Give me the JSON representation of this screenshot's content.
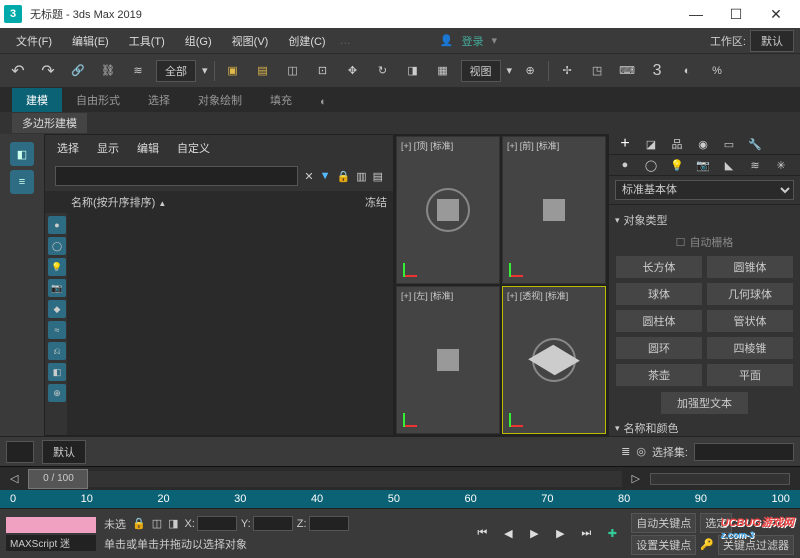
{
  "title": "无标题 - 3ds Max 2019",
  "menus": {
    "file": "文件(F)",
    "edit": "编辑(E)",
    "tools": "工具(T)",
    "group": "组(G)",
    "views": "视图(V)",
    "create": "创建(C)",
    "login": "登录",
    "workspace_label": "工作区:",
    "workspace_value": "默认"
  },
  "toolbar": {
    "all": "全部",
    "view": "视图"
  },
  "tabs": {
    "modeling": "建模",
    "freeform": "自由形式",
    "selection": "选择",
    "object_paint": "对象绘制",
    "fill": "填充"
  },
  "subtab": "多边形建模",
  "scene_explorer": {
    "menu": {
      "select": "选择",
      "display": "显示",
      "edit": "编辑",
      "custom": "自定义"
    },
    "columns": {
      "name": "名称(按升序排序)",
      "frozen": "冻结"
    }
  },
  "viewports": [
    {
      "label": "[+] [顶] [标准]"
    },
    {
      "label": "[+] [前] [标准]"
    },
    {
      "label": "[+] [左] [标准]"
    },
    {
      "label": "[+] [透视] [标准]"
    }
  ],
  "cmd_panel": {
    "category": "标准基本体",
    "object_type": "对象类型",
    "auto_grid": "自动栅格",
    "primitives": [
      [
        "长方体",
        "圆锥体"
      ],
      [
        "球体",
        "几何球体"
      ],
      [
        "圆柱体",
        "管状体"
      ],
      [
        "圆环",
        "四棱锥"
      ],
      [
        "茶壶",
        "平面"
      ]
    ],
    "reinforced_text": "加强型文本",
    "name_color": "名称和颜色"
  },
  "bottom": {
    "default": "默认",
    "selset_label": "选择集:"
  },
  "time": {
    "label": "0 / 100",
    "ticks": [
      "0",
      "10",
      "20",
      "30",
      "40",
      "50",
      "60",
      "70",
      "80",
      "90",
      "100"
    ]
  },
  "status": {
    "maxscript": "MAXScript 迷",
    "none": "未选",
    "hint": "单击或单击并拖动以选择对象",
    "x": "X:",
    "y": "Y:",
    "z": "Z:",
    "autokey": "自动关键点",
    "selected": "选定",
    "setkey": "设置关键点",
    "keyfilter": "关键点过滤器"
  },
  "watermark": {
    "main": "UCBUG游戏网",
    "sub": "z.com-3"
  }
}
